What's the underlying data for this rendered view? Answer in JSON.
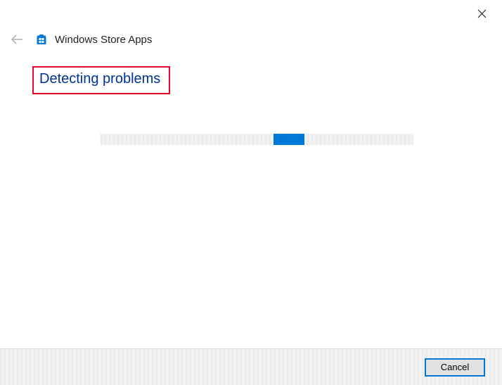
{
  "header": {
    "title": "Windows Store Apps"
  },
  "status": {
    "text": "Detecting problems"
  },
  "footer": {
    "cancel_label": "Cancel"
  },
  "colors": {
    "accent": "#0078d7",
    "highlight_border": "#e4032e",
    "status_text": "#003399"
  }
}
